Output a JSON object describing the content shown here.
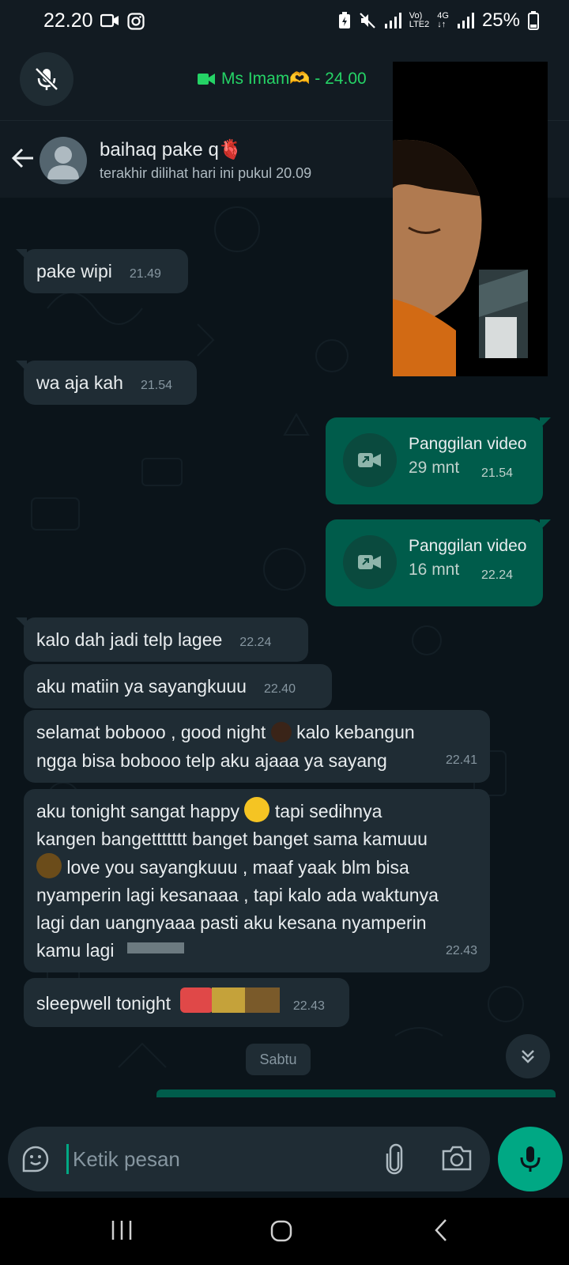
{
  "status_bar": {
    "time": "22.20",
    "net_top": "Vo)",
    "net_bottom": "LTE2",
    "net2_top": "4G",
    "battery": "25%"
  },
  "call_bar": {
    "label": "Ms Imam🫶 - 24.00"
  },
  "chat_header": {
    "contact_name": "baihaq pake q🫀",
    "last_seen": "terakhir dilihat hari ini pukul 20.09"
  },
  "messages": [
    {
      "text": "pake wipi",
      "time": "21.49"
    },
    {
      "text": "wa aja kah",
      "time": "21.54"
    },
    {
      "text": "kalo dah jadi telp lagee",
      "time": "22.24"
    },
    {
      "text": "aku matiin ya sayangkuuu",
      "time": "22.40"
    },
    {
      "line1a": "selamat bobooo , good night",
      "line1b": "kalo kebangun",
      "line2": "ngga bisa bobooo telp aku ajaaa ya sayang",
      "time": "22.41"
    },
    {
      "line1a": "aku tonight sangat happy",
      "line1b": "tapi sedihnya",
      "line2": "kangen bangettttttt banget banget sama kamuuu",
      "line3": "love you sayangkuuu , maaf yaak blm bisa",
      "line4": "nyamperin lagi kesanaaa , tapi kalo ada waktunya",
      "line5": "lagi dan uangnyaaa pasti aku kesana nyamperin",
      "line6": "kamu lagi",
      "time": "22.43"
    },
    {
      "text": "sleepwell tonight",
      "time": "22.43"
    }
  ],
  "calls": [
    {
      "title": "Panggilan video",
      "duration": "29 mnt",
      "time": "21.54"
    },
    {
      "title": "Panggilan video",
      "duration": "16 mnt",
      "time": "22.24"
    }
  ],
  "date_chip": "Sabtu",
  "input": {
    "placeholder": "Ketik pesan"
  },
  "colors": {
    "background": "#0b141a",
    "bar": "#121b22",
    "incoming_bubble": "#1f2c34",
    "outgoing_bubble": "#005c4b",
    "accent": "#00a884",
    "call_green": "#25d366"
  },
  "icons": [
    "mute-mic-icon",
    "video-camera-icon",
    "back-arrow-icon",
    "avatar-icon",
    "video-call-icon",
    "double-chevron-down-icon",
    "sticker-icon",
    "paperclip-icon",
    "camera-icon",
    "mic-icon",
    "recents-icon",
    "home-icon",
    "nav-back-icon"
  ]
}
